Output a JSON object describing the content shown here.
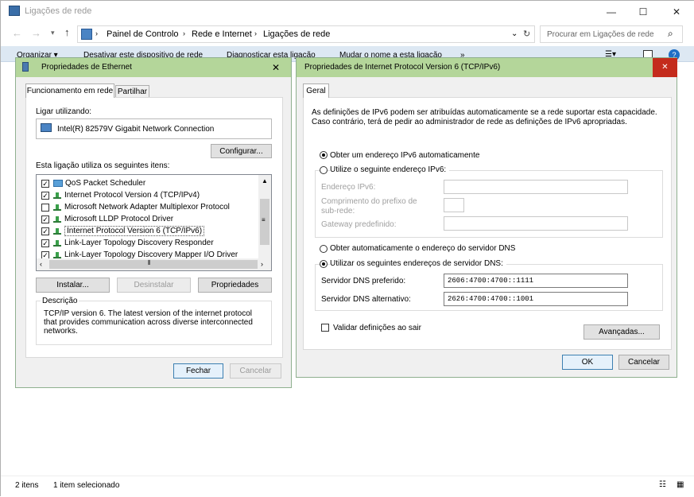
{
  "explorer": {
    "title": "Ligações de rede",
    "breadcrumb": [
      "Painel de Controlo",
      "Rede e Internet",
      "Ligações de rede"
    ],
    "search_placeholder": "Procurar em Ligações de rede",
    "commands": [
      "Organizar ▾",
      "Desativar este dispositivo de rede",
      "Diagnosticar esta ligação",
      "Mudar o nome a esta ligação",
      "»"
    ],
    "status": {
      "items": "2 itens",
      "selected": "1 item selecionado"
    }
  },
  "eth": {
    "title": "Propriedades de Ethernet",
    "tabs": [
      "Funcionamento em rede",
      "Partilhar"
    ],
    "connect_using_label": "Ligar utilizando:",
    "adapter": "Intel(R) 82579V Gigabit Network Connection",
    "configure_btn": "Configurar...",
    "items_label": "Esta ligação utiliza os seguintes itens:",
    "items": [
      {
        "label": "QoS Packet Scheduler",
        "checked": true
      },
      {
        "label": "Internet Protocol Version 4 (TCP/IPv4)",
        "checked": true
      },
      {
        "label": "Microsoft Network Adapter Multiplexor Protocol",
        "checked": false
      },
      {
        "label": "Microsoft LLDP Protocol Driver",
        "checked": true
      },
      {
        "label": "Internet Protocol Version 6 (TCP/IPv6)",
        "checked": true
      },
      {
        "label": "Link-Layer Topology Discovery Responder",
        "checked": true
      },
      {
        "label": "Link-Layer Topology Discovery Mapper I/O Driver",
        "checked": true
      }
    ],
    "install_btn": "Instalar...",
    "uninstall_btn": "Desinstalar",
    "properties_btn": "Propriedades",
    "description_label": "Descrição",
    "description": "TCP/IP version 6. The latest version of the internet protocol that provides communication across diverse interconnected networks.",
    "close_btn": "Fechar",
    "cancel_btn": "Cancelar"
  },
  "ipv6": {
    "title": "Propriedades de Internet Protocol Version 6 (TCP/IPv6)",
    "tab": "Geral",
    "intro": "As definições de IPv6 podem ser atribuídas automaticamente se a rede suportar esta capacidade. Caso contrário, terá de pedir ao administrador de rede as definições de IPv6 apropriadas.",
    "auto_ip": "Obter um endereço IPv6 automaticamente",
    "manual_ip": "Utilize o seguinte endereço IPv6:",
    "address_label": "Endereço IPv6:",
    "prefix_label": "Comprimento do prefixo de sub-rede:",
    "gateway_label": "Gateway predefinido:",
    "auto_dns": "Obter automaticamente o endereço do servidor DNS",
    "manual_dns": "Utilizar os seguintes endereços de servidor DNS:",
    "pref_dns_label": "Servidor DNS preferido:",
    "pref_dns": "2606:4700:4700::1111",
    "alt_dns_label": "Servidor DNS alternativo:",
    "alt_dns": "2626:4700:4700::1001",
    "validate_label": "Validar definições ao sair",
    "advanced_btn": "Avançadas...",
    "ok_btn": "OK",
    "cancel_btn": "Cancelar"
  }
}
